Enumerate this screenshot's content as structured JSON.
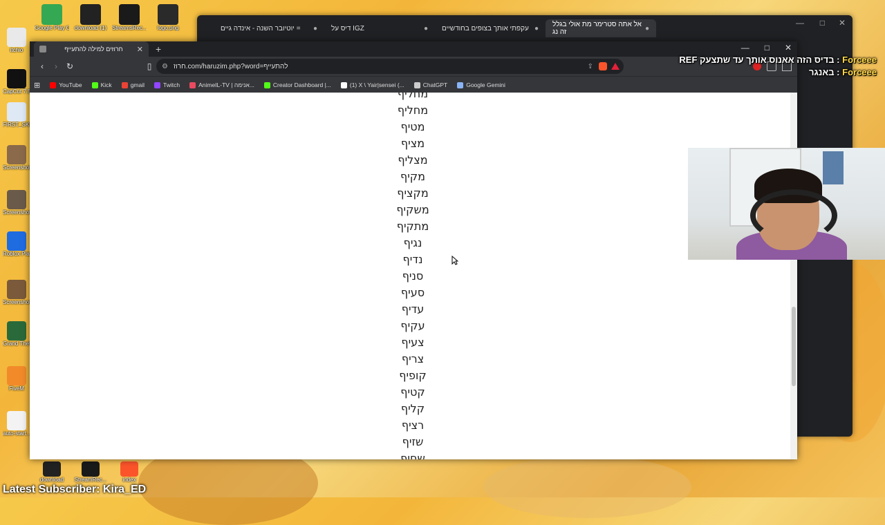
{
  "desktop_icons_left": [
    {
      "label": "itchio",
      "icon": "app-icon",
      "color": "#e9e9e9"
    },
    {
      "label": "CapCut 7.5",
      "icon": "capcut-icon",
      "color": "#111111"
    },
    {
      "label": "FIRST_SKE...",
      "icon": "image-icon",
      "color": "#dfe8f5"
    },
    {
      "label": "Screenshot 2025-10-...",
      "icon": "image-icon",
      "color": "#8a6a4a"
    },
    {
      "label": "Screenshot 2025-10-...",
      "icon": "image-icon",
      "color": "#6a5a4a"
    },
    {
      "label": "Roblox Player",
      "icon": "roblox-icon",
      "color": "#1f6be0"
    },
    {
      "label": "Screenshot 2025-11-...",
      "icon": "image-icon",
      "color": "#7a5a3a"
    },
    {
      "label": "Grand Theft Auto V",
      "icon": "gta-icon",
      "color": "#2a6a3a"
    },
    {
      "label": "FiveM",
      "icon": "fivem-icon",
      "color": "#f28a2a"
    },
    {
      "label": "auto-start...",
      "icon": "file-icon",
      "color": "#f3f3f3"
    },
    {
      "label": "Install Goo...",
      "icon": "google-play-icon",
      "color": "#2aa85a"
    }
  ],
  "desktop_icons_top": [
    {
      "label": "Google Play Games Beta",
      "icon": "google-play-icon",
      "color": "#34a853"
    },
    {
      "label": "download (1)",
      "icon": "image-icon",
      "color": "#222222"
    },
    {
      "label": "StreamsRec...",
      "icon": "app-icon",
      "color": "#1a1a1a"
    },
    {
      "label": "logo.png",
      "icon": "image-icon",
      "color": "#2a2a2a"
    }
  ],
  "desktop_icons_bottom": [
    {
      "label": "download",
      "icon": "image-icon",
      "color": "#222222"
    },
    {
      "label": "StreamRec...",
      "icon": "app-icon",
      "color": "#1a1a1a"
    },
    {
      "label": "index",
      "icon": "brave-icon",
      "color": "#fb542b"
    }
  ],
  "back_window": {
    "tabs": [
      {
        "label": "יוטיובר השנה - אינדה גיים ="
      },
      {
        "label": "דיס על IGZ"
      },
      {
        "label": "עקפתי אותך בצופים בחודשיים"
      },
      {
        "label": "אל אתה סטרימר מת אולי בגלל זה נג",
        "active": true
      }
    ]
  },
  "browser": {
    "tab_title": "חרוזים למילה להתעייף",
    "url": "חרוז.com/haruzim.php?word=להתעייף",
    "bookmarks": [
      {
        "label": "YouTube",
        "icon": "youtube-icon",
        "color": "#ff0000"
      },
      {
        "label": "Kick",
        "icon": "kick-icon",
        "color": "#53fc18"
      },
      {
        "label": "gmail",
        "icon": "gmail-icon",
        "color": "#ea4335"
      },
      {
        "label": "Twitch",
        "icon": "twitch-icon",
        "color": "#9146ff"
      },
      {
        "label": "AnimeIL-TV | אנימה...",
        "icon": "animeil-icon",
        "color": "#e84a5f"
      },
      {
        "label": "Creator Dashboard |...",
        "icon": "kick-icon",
        "color": "#53fc18"
      },
      {
        "label": "(1) X \\ Yair|sensei (...",
        "icon": "x-icon",
        "color": "#ffffff"
      },
      {
        "label": "ChatGPT",
        "icon": "chatgpt-icon",
        "color": "#cccccc"
      },
      {
        "label": "Google Gemini",
        "icon": "gemini-icon",
        "color": "#8ab4f8"
      }
    ]
  },
  "words": [
    "מחליף",
    "מחליף",
    "מטיף",
    "מציף",
    "מצליף",
    "מקיף",
    "מקציף",
    "משקיף",
    "מתקיף",
    "נגיף",
    "נדיף",
    "סניף",
    "סעיף",
    "עדיף",
    "עקיף",
    "צעיף",
    "צריף",
    "קופיף",
    "קטיף",
    "קליף",
    "רציף",
    "שזיף",
    "שחיף"
  ],
  "overlay": {
    "chat": [
      {
        "name": "Forceee",
        "message": "בדיס הזה אאנוס אותך עד שתצעק REF"
      },
      {
        "name": "Forceee",
        "message": "באנגר"
      }
    ],
    "latest_subscriber": "Latest Subscriber: Kira_ED"
  }
}
